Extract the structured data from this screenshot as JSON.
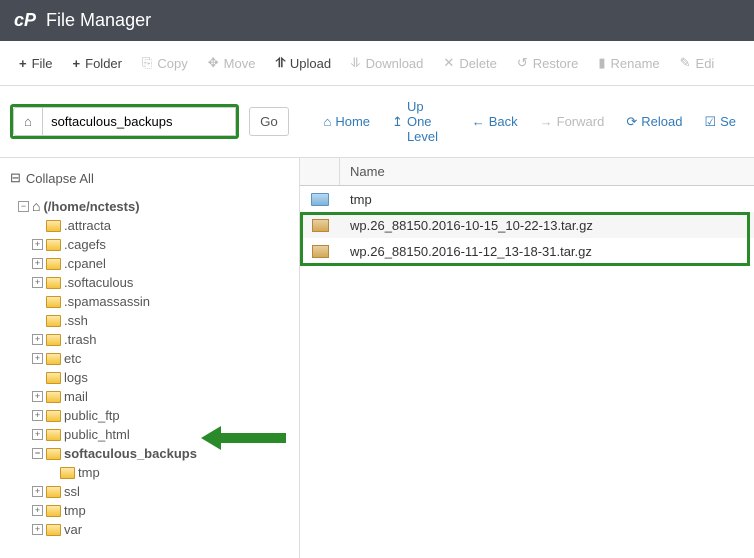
{
  "header": {
    "title": "File Manager"
  },
  "toolbar": {
    "file": "File",
    "folder": "Folder",
    "copy": "Copy",
    "move": "Move",
    "upload": "Upload",
    "download": "Download",
    "delete": "Delete",
    "restore": "Restore",
    "rename": "Rename",
    "edit": "Edi"
  },
  "path": {
    "value": "softaculous_backups",
    "go": "Go"
  },
  "nav": {
    "home": "Home",
    "up": "Up One Level",
    "back": "Back",
    "forward": "Forward",
    "reload": "Reload",
    "select": "Se"
  },
  "sidebar": {
    "collapse": "Collapse All",
    "root": "(/home/nctests)",
    "items": [
      ".attracta",
      ".cagefs",
      ".cpanel",
      ".softaculous",
      ".spamassassin",
      ".ssh",
      ".trash",
      "etc",
      "logs",
      "mail",
      "public_ftp",
      "public_html",
      "softaculous_backups",
      "tmp",
      "ssl",
      "tmp",
      "var"
    ]
  },
  "grid": {
    "name_header": "Name",
    "rows": [
      {
        "type": "folder",
        "name": "tmp"
      },
      {
        "type": "archive",
        "name": "wp.26_88150.2016-10-15_10-22-13.tar.gz"
      },
      {
        "type": "archive",
        "name": "wp.26_88150.2016-11-12_13-18-31.tar.gz"
      }
    ]
  }
}
